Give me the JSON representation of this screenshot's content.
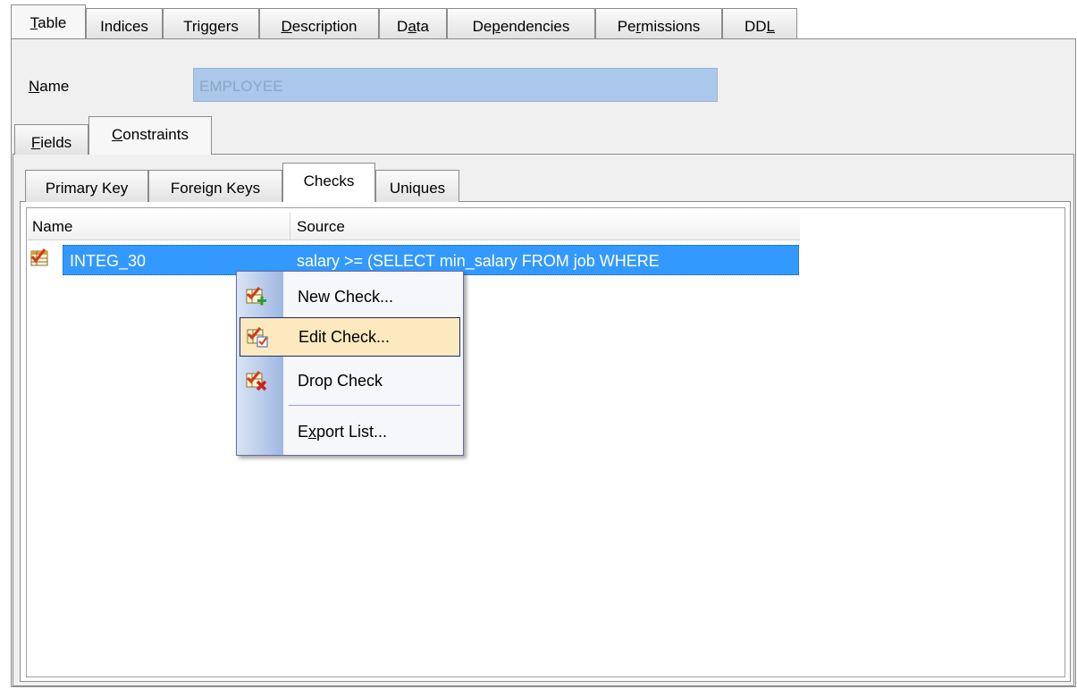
{
  "top_tabs": [
    {
      "label": "Table",
      "accel": "T",
      "rest": "able"
    },
    {
      "label": "Indices",
      "accel": "",
      "rest": "Indices"
    },
    {
      "label": "Triggers",
      "pre": "Tri",
      "accel": "g",
      "rest": "gers"
    },
    {
      "label": "Description",
      "accel": "D",
      "rest": "escription"
    },
    {
      "label": "Data",
      "pre": "D",
      "accel": "a",
      "rest": "ta"
    },
    {
      "label": "Dependencies",
      "pre": "De",
      "accel": "p",
      "rest": "endencies"
    },
    {
      "label": "Permissions",
      "pre": "Pe",
      "accel": "r",
      "rest": "missions"
    },
    {
      "label": "DDL",
      "pre": "DD",
      "accel": "L",
      "rest": ""
    }
  ],
  "name_field": {
    "label_accel": "N",
    "label_rest": "ame",
    "value": "EMPLOYEE"
  },
  "sub_tabs": [
    {
      "accel": "F",
      "rest": "ields"
    },
    {
      "accel": "C",
      "rest": "onstraints"
    }
  ],
  "constraint_tabs": [
    "Primary Key",
    "Foreign Keys",
    "Checks",
    "Uniques"
  ],
  "grid": {
    "columns": [
      "Name",
      "Source"
    ],
    "rows": [
      {
        "name": "INTEG_30",
        "source": "salary >= (SELECT min_salary FROM job WHERE"
      }
    ]
  },
  "context_menu": {
    "items": [
      {
        "label": "New Check...",
        "icon": "new-check-icon"
      },
      {
        "label": "Edit Check...",
        "icon": "edit-check-icon"
      },
      {
        "label": "Drop Check",
        "icon": "drop-check-icon"
      },
      {
        "label": "Export List...",
        "icon": "",
        "pre": "E",
        "accel": "x",
        "rest": "port List..."
      }
    ],
    "highlighted": "Edit Check..."
  },
  "colors": {
    "selection": "#3399ff",
    "menu_highlight": "#fce9bf",
    "name_field_bg": "#a9c8ea"
  }
}
